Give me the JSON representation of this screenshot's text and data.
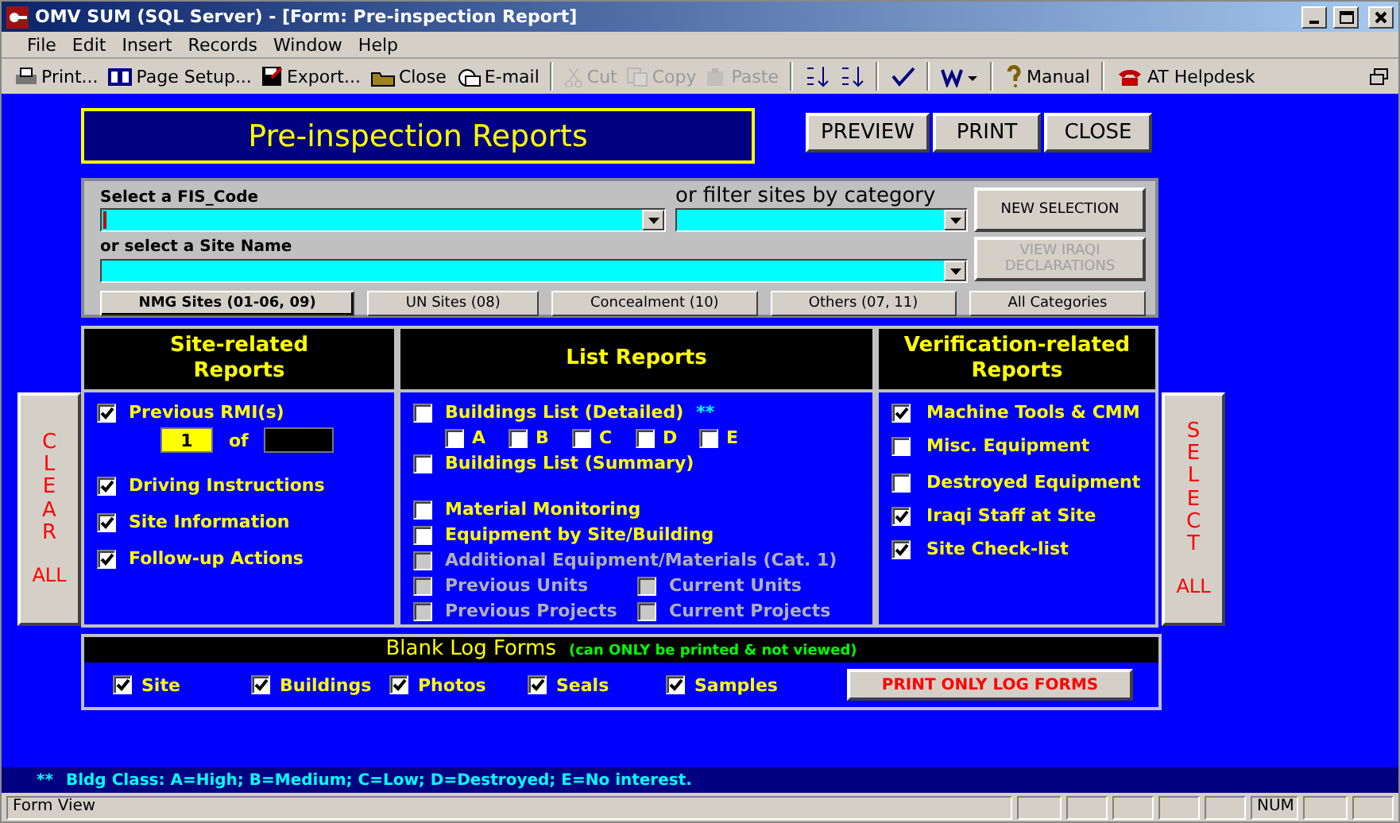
{
  "window": {
    "title": "OMV SUM (SQL Server) - [Form: Pre-inspection Report]"
  },
  "menu": [
    "File",
    "Edit",
    "Insert",
    "Records",
    "Window",
    "Help"
  ],
  "toolbar": [
    [
      {
        "label": "Print...",
        "disabled": false
      },
      {
        "label": "Page Setup...",
        "disabled": false
      },
      {
        "label": "Export...",
        "disabled": false
      },
      {
        "label": "Close",
        "disabled": false
      },
      {
        "label": "E-mail",
        "disabled": false
      }
    ],
    [
      {
        "label": "Cut",
        "disabled": true
      },
      {
        "label": "Copy",
        "disabled": true
      },
      {
        "label": "Paste",
        "disabled": true
      }
    ],
    [
      {
        "disabled": false
      },
      {
        "disabled": false
      }
    ],
    [
      {
        "disabled": false
      }
    ],
    [
      {
        "disabled": false
      }
    ],
    [
      {
        "label": "Manual",
        "disabled": false
      }
    ],
    [
      {
        "label": "AT Helpdesk",
        "disabled": false
      }
    ]
  ],
  "form": {
    "title": "Pre-inspection Reports",
    "buttons": [
      "PREVIEW",
      "PRINT",
      "CLOSE"
    ]
  },
  "selection": {
    "fis_label": "Select a FIS_Code",
    "category_label": "or filter sites by category",
    "site_label": "or select a Site Name",
    "side_buttons": [
      {
        "label": "NEW SELECTION",
        "disabled": false
      },
      {
        "label": "VIEW IRAQI DECLARATIONS",
        "disabled": true
      }
    ],
    "categories": [
      {
        "label": "NMG Sites (01-06, 09)",
        "selected": true
      },
      {
        "label": "UN Sites (08)",
        "selected": false
      },
      {
        "label": "Concealment (10)",
        "selected": false
      },
      {
        "label": "Others (07, 11)",
        "selected": false
      },
      {
        "label": "All Categories",
        "selected": false
      }
    ]
  },
  "clear_all": {
    "letters": "CLEAR",
    "all": "ALL"
  },
  "select_all": {
    "letters": "SELECT",
    "all": "ALL"
  },
  "site_reports": {
    "title": "Site-related Reports",
    "rmi": {
      "label": "Previous RMI(s)",
      "checked": true,
      "value": "1",
      "of": "of"
    },
    "items": [
      {
        "label": "Driving Instructions",
        "checked": true
      },
      {
        "label": "Site Information",
        "checked": true
      },
      {
        "label": "Follow-up Actions",
        "checked": true
      }
    ]
  },
  "list_reports": {
    "title": "List Reports",
    "groups": [
      [
        {
          "kind": "check",
          "label": "Buildings List (Detailed)",
          "note": "**",
          "checked": false,
          "disabled": false
        },
        {
          "kind": "letters",
          "options": [
            {
              "label": "A",
              "checked": false
            },
            {
              "label": "B",
              "checked": false
            },
            {
              "label": "C",
              "checked": false
            },
            {
              "label": "D",
              "checked": false
            },
            {
              "label": "E",
              "checked": false
            }
          ]
        },
        {
          "kind": "check",
          "label": "Buildings List (Summary)",
          "checked": false,
          "disabled": false
        }
      ],
      [
        {
          "kind": "check",
          "label": "Material Monitoring",
          "checked": false,
          "disabled": false
        },
        {
          "kind": "check",
          "label": "Equipment by Site/Building",
          "checked": false,
          "disabled": false
        },
        {
          "kind": "check",
          "label": "Additional Equipment/Materials (Cat. 1)",
          "checked": false,
          "disabled": true
        },
        {
          "kind": "pair",
          "pair": [
            {
              "label": "Previous Units",
              "checked": false,
              "disabled": true
            },
            {
              "label": "Current Units",
              "checked": false,
              "disabled": true
            }
          ]
        },
        {
          "kind": "pair",
          "pair": [
            {
              "label": "Previous Projects",
              "checked": false,
              "disabled": true
            },
            {
              "label": "Current Projects",
              "checked": false,
              "disabled": true
            }
          ]
        }
      ]
    ]
  },
  "verification_reports": {
    "title": "Verification-related Reports",
    "items": [
      {
        "label": "Machine Tools & CMM",
        "checked": true
      },
      {
        "label": "Misc. Equipment",
        "checked": false
      },
      {
        "label": "Destroyed Equipment",
        "checked": false
      },
      {
        "label": "Iraqi Staff at Site",
        "checked": true
      },
      {
        "label": "Site Check-list",
        "checked": true
      }
    ]
  },
  "log_forms": {
    "title": "Blank Log Forms",
    "subtitle": "(can ONLY be printed & not viewed)",
    "items": [
      {
        "label": "Site",
        "checked": true
      },
      {
        "label": "Buildings",
        "checked": true
      },
      {
        "label": "Photos",
        "checked": true
      },
      {
        "label": "Seals",
        "checked": true
      },
      {
        "label": "Samples",
        "checked": true
      }
    ],
    "button": "PRINT ONLY LOG FORMS"
  },
  "footnote": {
    "mark": "**",
    "text": "Bldg Class: A=High; B=Medium; C=Low; D=Destroyed; E=No interest."
  },
  "status_bar": {
    "text": "Form View",
    "indicator": "NUM"
  }
}
